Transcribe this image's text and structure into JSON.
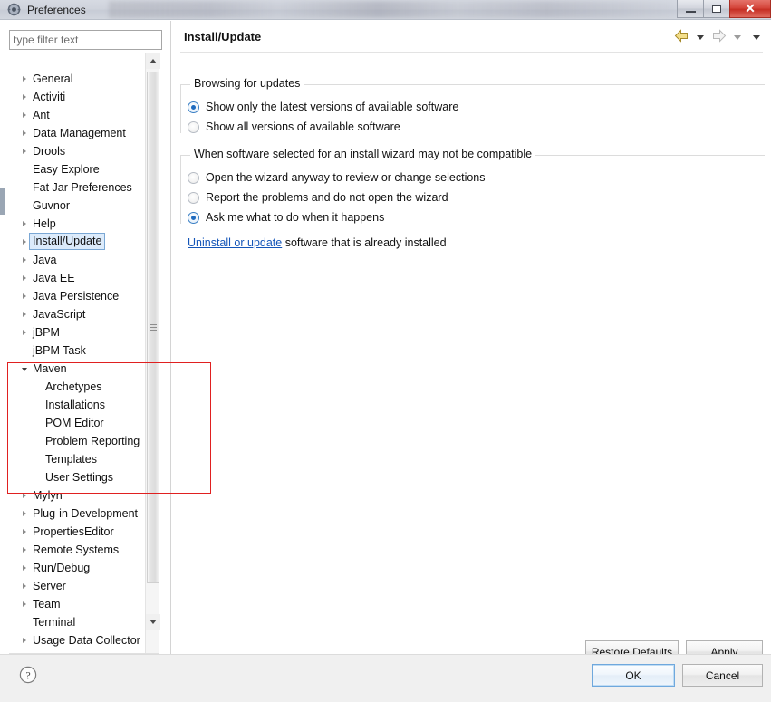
{
  "window": {
    "title": "Preferences",
    "app_icon": "gear-icon",
    "controls": {
      "minimize": "minimize-icon",
      "maximize": "maximize-icon",
      "close": "✕"
    }
  },
  "sidebar": {
    "filter": {
      "placeholder": "type filter text",
      "value": ""
    },
    "items": [
      {
        "label": "General",
        "expandable": true,
        "level": 0,
        "state": "collapsed"
      },
      {
        "label": "Activiti",
        "expandable": true,
        "level": 0,
        "state": "collapsed"
      },
      {
        "label": "Ant",
        "expandable": true,
        "level": 0,
        "state": "collapsed"
      },
      {
        "label": "Data Management",
        "expandable": true,
        "level": 0,
        "state": "collapsed"
      },
      {
        "label": "Drools",
        "expandable": true,
        "level": 0,
        "state": "collapsed"
      },
      {
        "label": "Easy Explore",
        "expandable": false,
        "level": 0,
        "state": "leaf"
      },
      {
        "label": "Fat Jar Preferences",
        "expandable": false,
        "level": 0,
        "state": "leaf"
      },
      {
        "label": "Guvnor",
        "expandable": false,
        "level": 0,
        "state": "leaf"
      },
      {
        "label": "Help",
        "expandable": true,
        "level": 0,
        "state": "collapsed"
      },
      {
        "label": "Install/Update",
        "expandable": true,
        "level": 0,
        "state": "collapsed",
        "selected": true
      },
      {
        "label": "Java",
        "expandable": true,
        "level": 0,
        "state": "collapsed"
      },
      {
        "label": "Java EE",
        "expandable": true,
        "level": 0,
        "state": "collapsed"
      },
      {
        "label": "Java Persistence",
        "expandable": true,
        "level": 0,
        "state": "collapsed"
      },
      {
        "label": "JavaScript",
        "expandable": true,
        "level": 0,
        "state": "collapsed"
      },
      {
        "label": "jBPM",
        "expandable": true,
        "level": 0,
        "state": "collapsed"
      },
      {
        "label": "jBPM Task",
        "expandable": false,
        "level": 0,
        "state": "leaf"
      },
      {
        "label": "Maven",
        "expandable": true,
        "level": 0,
        "state": "expanded"
      },
      {
        "label": "Archetypes",
        "expandable": false,
        "level": 1,
        "state": "leaf"
      },
      {
        "label": "Installations",
        "expandable": false,
        "level": 1,
        "state": "leaf"
      },
      {
        "label": "POM Editor",
        "expandable": false,
        "level": 1,
        "state": "leaf"
      },
      {
        "label": "Problem Reporting",
        "expandable": false,
        "level": 1,
        "state": "leaf"
      },
      {
        "label": "Templates",
        "expandable": false,
        "level": 1,
        "state": "leaf"
      },
      {
        "label": "User Settings",
        "expandable": false,
        "level": 1,
        "state": "leaf"
      },
      {
        "label": "Mylyn",
        "expandable": true,
        "level": 0,
        "state": "collapsed"
      },
      {
        "label": "Plug-in Development",
        "expandable": true,
        "level": 0,
        "state": "collapsed"
      },
      {
        "label": "PropertiesEditor",
        "expandable": true,
        "level": 0,
        "state": "collapsed"
      },
      {
        "label": "Remote Systems",
        "expandable": true,
        "level": 0,
        "state": "collapsed"
      },
      {
        "label": "Run/Debug",
        "expandable": true,
        "level": 0,
        "state": "collapsed"
      },
      {
        "label": "Server",
        "expandable": true,
        "level": 0,
        "state": "collapsed"
      },
      {
        "label": "Team",
        "expandable": true,
        "level": 0,
        "state": "collapsed"
      },
      {
        "label": "Terminal",
        "expandable": false,
        "level": 0,
        "state": "leaf"
      },
      {
        "label": "Usage Data Collector",
        "expandable": true,
        "level": 0,
        "state": "collapsed"
      }
    ]
  },
  "annotation": {
    "color": "#e02020",
    "target": "Maven"
  },
  "pane": {
    "title": "Install/Update",
    "nav": {
      "back": "back-arrow-icon",
      "back_dropdown": "chevron-down-icon",
      "forward": "forward-arrow-icon",
      "forward_dropdown": "chevron-down-icon",
      "menu": "chevron-down-icon"
    },
    "groups": [
      {
        "title": "Browsing for updates",
        "options": [
          {
            "label": "Show only the latest versions of available software",
            "checked": true
          },
          {
            "label": "Show all versions of available software",
            "checked": false
          }
        ]
      },
      {
        "title": "When software selected for an install wizard may not be compatible",
        "options": [
          {
            "label": "Open the wizard anyway to review or change selections",
            "checked": false
          },
          {
            "label": "Report the problems and do not open the wizard",
            "checked": false
          },
          {
            "label": "Ask me what to do when it happens",
            "checked": true
          }
        ]
      }
    ],
    "link": {
      "link_text": "Uninstall or update",
      "suffix_text": " software that is already installed"
    },
    "buttons": {
      "restore_defaults": "Restore Defaults",
      "apply": "Apply"
    }
  },
  "footer": {
    "help_icon": "help-question-icon",
    "ok": "OK",
    "cancel": "Cancel"
  }
}
